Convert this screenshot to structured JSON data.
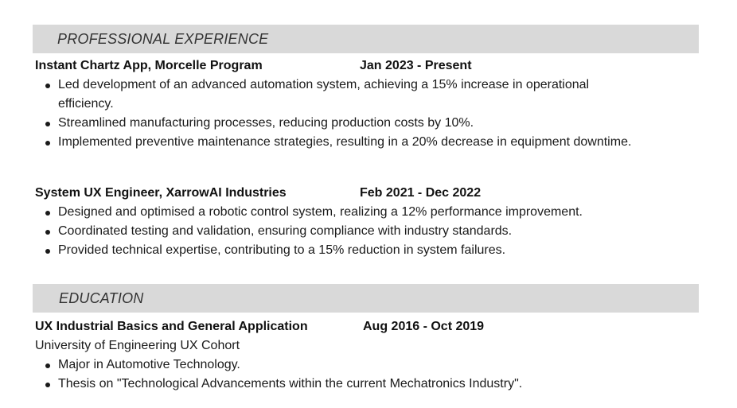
{
  "experience": {
    "heading": "PROFESSIONAL EXPERIENCE",
    "jobs": [
      {
        "org": "Instant Chartz App, Morcelle Program",
        "dates": "Jan 2023 - Present",
        "bullets": [
          "Led development of an advanced automation system, achieving a 15% increase in operational efficiency.",
          "Streamlined manufacturing processes, reducing production costs by 10%.",
          "Implemented preventive maintenance strategies, resulting in a 20% decrease in equipment downtime."
        ]
      },
      {
        "org": "System UX Engineer, XarrowAI Industries",
        "dates": "Feb 2021 - Dec 2022",
        "bullets": [
          "Designed and optimised a robotic control system, realizing a 12% performance improvement.",
          "Coordinated testing and validation, ensuring compliance with industry standards.",
          "Provided technical expertise, contributing to a 15% reduction in system failures."
        ]
      }
    ]
  },
  "education": {
    "heading": "EDUCATION",
    "program": "UX Industrial Basics and General Application",
    "dates": "Aug 2016 - Oct 2019",
    "school": "University of Engineering UX Cohort",
    "bullets": [
      "Major in Automotive Technology.",
      "Thesis on \"Technological Advancements within the current Mechatronics Industry\"."
    ]
  }
}
